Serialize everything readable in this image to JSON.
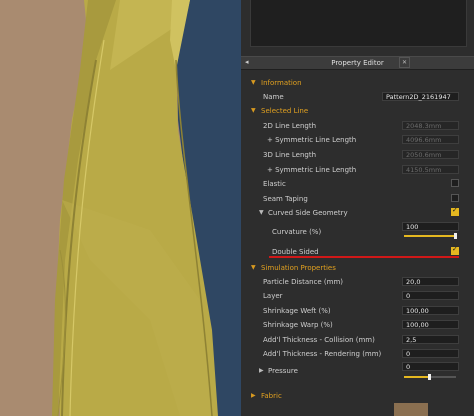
{
  "panel": {
    "title": "Property Editor",
    "pin_icon": "pin-icon",
    "close_icon": "close-icon"
  },
  "information": {
    "label": "Information",
    "name_label": "Name",
    "name_value": "Pattern2D_2161947"
  },
  "selected_line": {
    "label": "Selected Line",
    "line_2d_label": "2D Line Length",
    "line_2d_value": "2048.3mm",
    "sym_2d_label": "+ Symmetric Line Length",
    "sym_2d_value": "4096.6mm",
    "line_3d_label": "3D Line Length",
    "line_3d_value": "2050.6mm",
    "sym_3d_label": "+ Symmetric Line Length",
    "sym_3d_value": "4150.5mm",
    "elastic_label": "Elastic",
    "elastic_checked": false,
    "seam_label": "Seam Taping",
    "seam_checked": false,
    "curved_label": "Curved Side Geometry",
    "curved_checked": true,
    "curvature_label": "Curvature (%)",
    "curvature_value": "100",
    "curvature_level": 1.0,
    "double_label": "Double Sided",
    "double_checked": true
  },
  "simulation": {
    "label": "Simulation Properties",
    "particle_label": "Particle Distance (mm)",
    "particle_value": "20,0",
    "layer_label": "Layer",
    "layer_value": "0",
    "weft_label": "Shrinkage Weft (%)",
    "weft_value": "100,00",
    "warp_label": "Shrinkage Warp (%)",
    "warp_value": "100,00",
    "thick_coll_label": "Add'l Thickness - Collision (mm)",
    "thick_coll_value": "2,5",
    "thick_rend_label": "Add'l Thickness - Rendering (mm)",
    "thick_rend_value": "0",
    "pressure_label": "Pressure",
    "pressure_value": "0",
    "pressure_level": 0.5
  },
  "fabric": {
    "label": "Fabric",
    "swatch_color": "#8a6f50"
  },
  "colors": {
    "accent": "#e5b820",
    "section": "#e0a020",
    "highlight_line": "#d01818"
  }
}
